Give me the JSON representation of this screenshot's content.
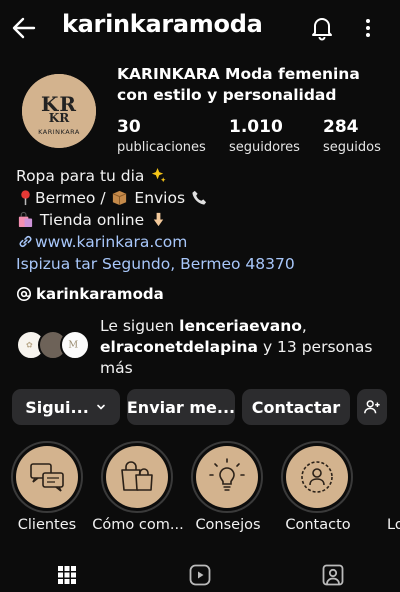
{
  "header": {
    "username": "karinkaramoda",
    "icons": {
      "back": "back-arrow-icon",
      "notifications": "bell-icon",
      "more": "more-vertical-icon"
    }
  },
  "profile": {
    "avatar_logo_text": "KRKR KARINKARA",
    "full_name": "KARINKARA Moda femenina con estilo y personalidad",
    "stats": {
      "posts": {
        "count": "30",
        "label": "publicaciones"
      },
      "followers": {
        "count": "1.010",
        "label": "seguidores"
      },
      "following": {
        "count": "284",
        "label": "seguidos"
      }
    },
    "bio": {
      "line1": "Ropa para tu dia",
      "line2_a": "Bermeo / ",
      "line2_b": " Envios",
      "line3": " Tienda online ",
      "link": "www.karinkara.com",
      "address": "Ispizua tar Segundo, Bermeo 48370"
    },
    "threads_handle": "karinkaramoda",
    "followed_by": {
      "prefix": "Le siguen ",
      "user1": "lenceriaevano",
      "sep": ",",
      "user2": "elraconetdelapina",
      "suffix": " y 13 personas más"
    }
  },
  "actions": {
    "following": "Sigui...",
    "message": "Enviar me...",
    "contact": "Contactar"
  },
  "highlights": [
    {
      "label": "Clientes",
      "icon": "chat-bubbles-icon"
    },
    {
      "label": "Cómo com...",
      "icon": "shopping-bags-icon"
    },
    {
      "label": "Consejos",
      "icon": "lightbulb-icon"
    },
    {
      "label": "Contacto",
      "icon": "contact-person-icon"
    },
    {
      "label": "Lo"
    }
  ],
  "tabs": [
    "grid-icon",
    "reels-icon",
    "tagged-icon"
  ],
  "colors": {
    "background": "#0c0c0c",
    "button": "#2c2c2e",
    "link": "#a8c7fa",
    "highlight_bg": "#d3b38e"
  }
}
